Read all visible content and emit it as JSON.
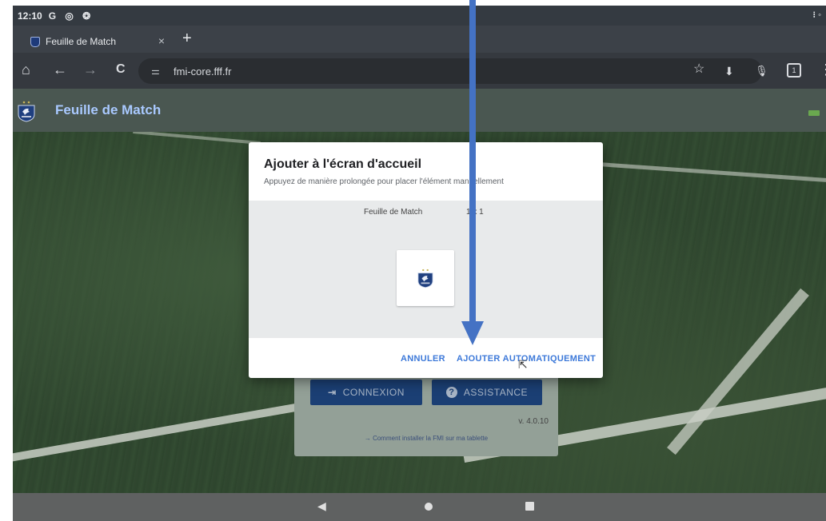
{
  "status_bar": {
    "time": "12:10",
    "icons": "G ◎ ❂",
    "right_icons": "⁝ ◦"
  },
  "tab": {
    "title": "Feuille de Match",
    "close": "×",
    "new_tab": "+"
  },
  "toolbar": {
    "home": "⌂",
    "back": "←",
    "forward": "→",
    "reload": "C",
    "site_icon": "⚌",
    "url": "fmi-core.fff.fr",
    "star": "☆",
    "download": "⬇",
    "mic": "🎙",
    "tab_count": "1",
    "menu": "⋮"
  },
  "app": {
    "title": "Feuille de Match",
    "brand_color": "#a9c9ff"
  },
  "dialog": {
    "title": "Ajouter à l'écran d'accueil",
    "subtitle": "Appuyez de manière prolongée pour placer l'élément manuellement",
    "widget_name": "Feuille de Match",
    "widget_size": "1 x 1",
    "cancel_label": "ANNULER",
    "add_label": "AJOUTER AUTOMATIQUEMENT"
  },
  "login": {
    "connexion_icon": "⇥",
    "connexion_label": "CONNEXION",
    "assistance_icon": "?",
    "assistance_label": "ASSISTANCE",
    "version": "v. 4.0.10",
    "help_link": "→ Comment installer la FMI sur ma tablette"
  },
  "nav": {
    "back": "◀"
  },
  "colors": {
    "accent": "#3d79d9",
    "arrow": "#4472c4",
    "header_blue": "#1b3f74"
  }
}
